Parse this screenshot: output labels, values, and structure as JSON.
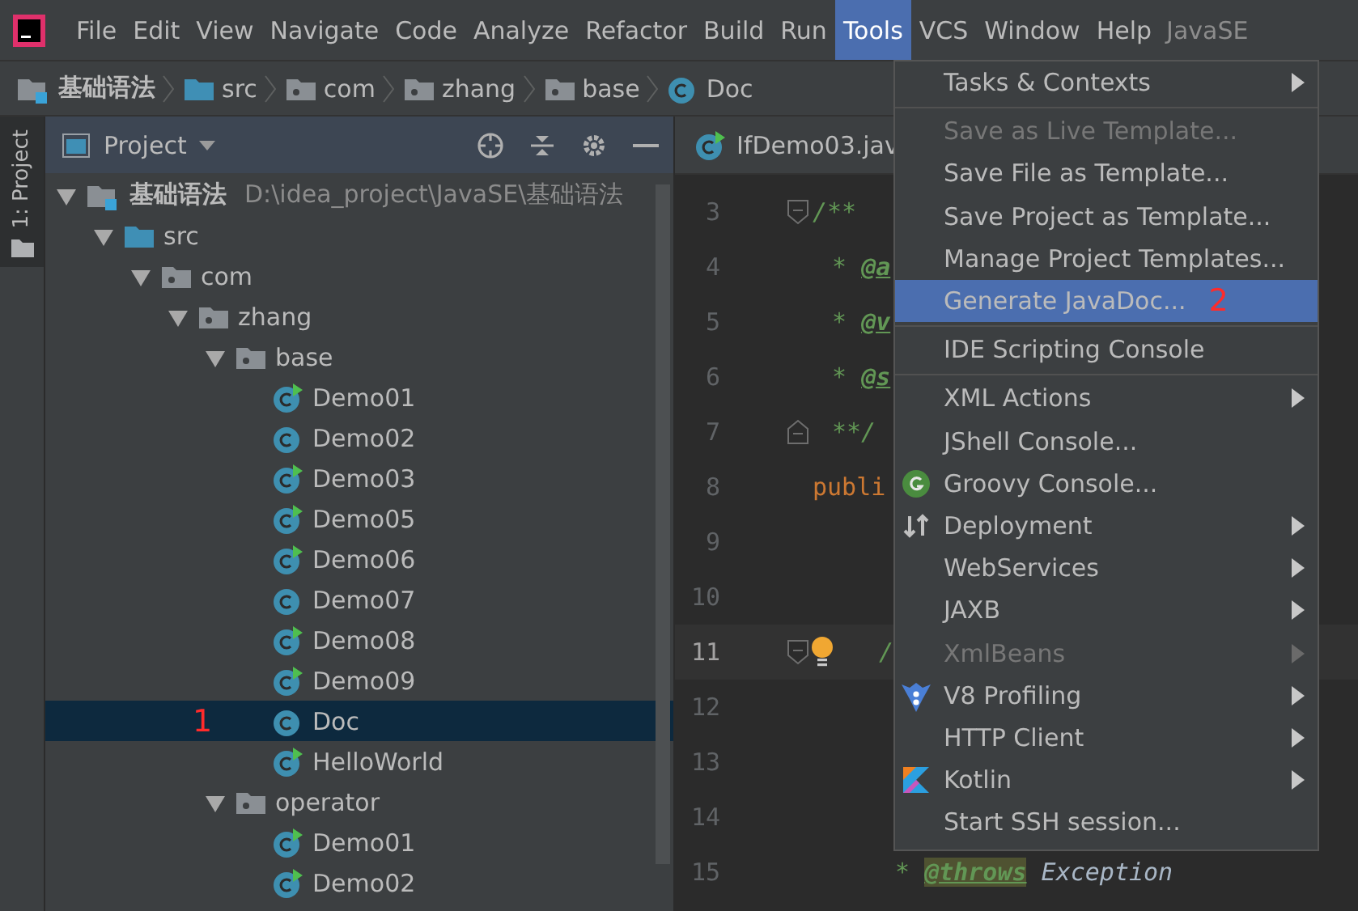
{
  "menubar": {
    "items": [
      {
        "label": "File",
        "selected": false
      },
      {
        "label": "Edit",
        "selected": false
      },
      {
        "label": "View",
        "selected": false
      },
      {
        "label": "Navigate",
        "selected": false
      },
      {
        "label": "Code",
        "selected": false
      },
      {
        "label": "Analyze",
        "selected": false
      },
      {
        "label": "Refactor",
        "selected": false
      },
      {
        "label": "Build",
        "selected": false
      },
      {
        "label": "Run",
        "selected": false
      },
      {
        "label": "Tools",
        "selected": true
      },
      {
        "label": "VCS",
        "selected": false
      },
      {
        "label": "Window",
        "selected": false
      },
      {
        "label": "Help",
        "selected": false
      }
    ],
    "project_title": "JavaSE"
  },
  "breadcrumb": [
    {
      "label": "基础语法",
      "kind": "module"
    },
    {
      "label": "src",
      "kind": "source"
    },
    {
      "label": "com",
      "kind": "package"
    },
    {
      "label": "zhang",
      "kind": "package"
    },
    {
      "label": "base",
      "kind": "package"
    },
    {
      "label": "Doc",
      "kind": "class"
    }
  ],
  "side_strip": {
    "tab": "1: Project"
  },
  "project_panel": {
    "title": "Project",
    "tree": [
      {
        "label": "基础语法",
        "path": "D:\\idea_project\\JavaSE\\基础语法",
        "kind": "module",
        "expanded": true,
        "selected": false,
        "children": [
          {
            "label": "src",
            "kind": "source",
            "expanded": true,
            "selected": false,
            "children": [
              {
                "label": "com",
                "kind": "package",
                "expanded": true,
                "selected": false,
                "children": [
                  {
                    "label": "zhang",
                    "kind": "package",
                    "expanded": true,
                    "selected": false,
                    "children": [
                      {
                        "label": "base",
                        "kind": "package",
                        "expanded": true,
                        "selected": false,
                        "children": [
                          {
                            "label": "Demo01",
                            "kind": "class",
                            "runnable": true,
                            "selected": false
                          },
                          {
                            "label": "Demo02",
                            "kind": "class",
                            "runnable": false,
                            "selected": false
                          },
                          {
                            "label": "Demo03",
                            "kind": "class",
                            "runnable": true,
                            "selected": false
                          },
                          {
                            "label": "Demo05",
                            "kind": "class",
                            "runnable": true,
                            "selected": false
                          },
                          {
                            "label": "Demo06",
                            "kind": "class",
                            "runnable": true,
                            "selected": false
                          },
                          {
                            "label": "Demo07",
                            "kind": "class",
                            "runnable": false,
                            "selected": false
                          },
                          {
                            "label": "Demo08",
                            "kind": "class",
                            "runnable": true,
                            "selected": false
                          },
                          {
                            "label": "Demo09",
                            "kind": "class",
                            "runnable": true,
                            "selected": false
                          },
                          {
                            "label": "Doc",
                            "kind": "class",
                            "runnable": false,
                            "selected": true,
                            "annotation": "1"
                          },
                          {
                            "label": "HelloWorld",
                            "kind": "class",
                            "runnable": true,
                            "selected": false
                          }
                        ]
                      },
                      {
                        "label": "operator",
                        "kind": "package",
                        "expanded": true,
                        "selected": false,
                        "children": [
                          {
                            "label": "Demo01",
                            "kind": "class",
                            "runnable": true,
                            "selected": false
                          },
                          {
                            "label": "Demo02",
                            "kind": "class",
                            "runnable": true,
                            "selected": false
                          }
                        ]
                      }
                    ]
                  }
                ]
              }
            ]
          }
        ]
      }
    ]
  },
  "editor": {
    "tab": "IfDemo03.jav",
    "lines": [
      {
        "number": "3",
        "fold_start": true,
        "current": false,
        "segments": [
          {
            "text": "/**",
            "kind": "doc"
          }
        ]
      },
      {
        "number": "4",
        "current": false,
        "segments": [
          {
            "text": "* ",
            "kind": "doc"
          },
          {
            "text": "@a",
            "kind": "tag"
          }
        ]
      },
      {
        "number": "5",
        "current": false,
        "segments": [
          {
            "text": "* ",
            "kind": "doc"
          },
          {
            "text": "@v",
            "kind": "tag"
          }
        ]
      },
      {
        "number": "6",
        "current": false,
        "segments": [
          {
            "text": "* ",
            "kind": "doc"
          },
          {
            "text": "@s",
            "kind": "tag"
          }
        ]
      },
      {
        "number": "7",
        "fold_end": true,
        "current": false,
        "segments": [
          {
            "text": "**/",
            "kind": "doc"
          }
        ]
      },
      {
        "number": "8",
        "current": false,
        "segments": [
          {
            "text": "publi",
            "kind": "keyword"
          }
        ]
      },
      {
        "number": "9",
        "current": false
      },
      {
        "number": "10",
        "current": false
      },
      {
        "number": "11",
        "fold_start": true,
        "current": true,
        "bulb": true,
        "segments": [
          {
            "text": "/",
            "kind": "doc"
          }
        ]
      },
      {
        "number": "12",
        "current": false
      },
      {
        "number": "13",
        "current": false
      },
      {
        "number": "14",
        "current": false
      },
      {
        "number": "15",
        "current": false,
        "segments": [
          {
            "text": "* ",
            "kind": "doc"
          },
          {
            "text": "@throws",
            "kind": "tag"
          },
          {
            "text": " Exception",
            "kind": "italic"
          }
        ]
      }
    ]
  },
  "tools_menu": [
    {
      "kind": "item",
      "label": "Tasks & Contexts",
      "submenu": true,
      "disabled": false,
      "selected": false
    },
    {
      "kind": "separator"
    },
    {
      "kind": "item",
      "label": "Save as Live Template...",
      "submenu": false,
      "disabled": true,
      "selected": false
    },
    {
      "kind": "item",
      "label": "Save File as Template...",
      "submenu": false,
      "disabled": false,
      "selected": false
    },
    {
      "kind": "item",
      "label": "Save Project as Template...",
      "submenu": false,
      "disabled": false,
      "selected": false
    },
    {
      "kind": "item",
      "label": "Manage Project Templates...",
      "submenu": false,
      "disabled": false,
      "selected": false
    },
    {
      "kind": "item",
      "label": "Generate JavaDoc...",
      "submenu": false,
      "disabled": false,
      "selected": true,
      "annotation": "2"
    },
    {
      "kind": "separator"
    },
    {
      "kind": "item",
      "label": "IDE Scripting Console",
      "submenu": false,
      "disabled": false,
      "selected": false
    },
    {
      "kind": "separator"
    },
    {
      "kind": "item",
      "label": "XML Actions",
      "submenu": true,
      "disabled": false,
      "selected": false
    },
    {
      "kind": "item",
      "label": "JShell Console...",
      "submenu": false,
      "disabled": false,
      "selected": false
    },
    {
      "kind": "groovy",
      "label": "Groovy Console...",
      "submenu": false,
      "disabled": false,
      "selected": false
    },
    {
      "kind": "deploy",
      "label": "Deployment",
      "submenu": true,
      "disabled": false,
      "selected": false
    },
    {
      "kind": "item",
      "label": "WebServices",
      "submenu": true,
      "disabled": false,
      "selected": false
    },
    {
      "kind": "item",
      "label": "JAXB",
      "submenu": true,
      "disabled": false,
      "selected": false
    },
    {
      "kind": "item",
      "label": "XmlBeans",
      "submenu": true,
      "disabled": true,
      "selected": false
    },
    {
      "kind": "v8",
      "label": "V8 Profiling",
      "submenu": true,
      "disabled": false,
      "selected": false
    },
    {
      "kind": "item",
      "label": "HTTP Client",
      "submenu": true,
      "disabled": false,
      "selected": false
    },
    {
      "kind": "kotlin",
      "label": "Kotlin",
      "submenu": true,
      "disabled": false,
      "selected": false
    },
    {
      "kind": "item",
      "label": "Start SSH session...",
      "submenu": false,
      "disabled": false,
      "selected": false
    }
  ]
}
